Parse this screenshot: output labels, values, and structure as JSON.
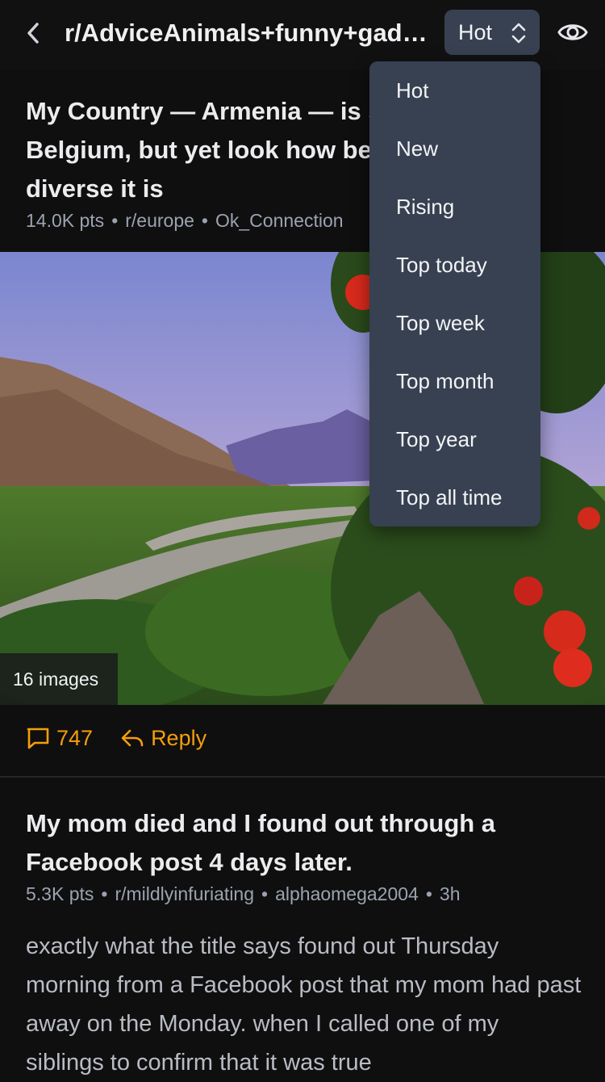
{
  "header": {
    "title": "r/AdviceAnimals+funny+gadgets+gaming+mildlyinfuriating+europe",
    "back_icon": "chevron-left-icon",
    "sort_value": "Hot",
    "sort_icon": "chevron-up-down-icon",
    "view_icon": "eye-icon"
  },
  "sort_menu": {
    "options": [
      "Hot",
      "New",
      "Rising",
      "Top today",
      "Top week",
      "Top month",
      "Top year",
      "Top all time"
    ]
  },
  "posts": [
    {
      "title": "My Country — Armenia — is smaller than Belgium, but yet look how beautiful and diverse it is",
      "points": "14.0K pts",
      "subreddit": "r/europe",
      "author": "Ok_Connection",
      "image_count": "16 images",
      "comments": "747",
      "reply_label": "Reply"
    },
    {
      "title": "My mom died and I found out through a Facebook post 4 days later.",
      "points": "5.3K pts",
      "subreddit": "r/mildlyinfuriating",
      "author": "alphaomega2004",
      "age": "3h",
      "body": "exactly what the title says found out Thursday morning from a Facebook post that my mom had past away on the Monday. when I called one of my siblings to confirm that it was true"
    }
  ],
  "colors": {
    "background": "#0f0f10",
    "accent": "#f59e0b",
    "menu_bg": "#374151",
    "meta_text": "#9ca3af"
  }
}
